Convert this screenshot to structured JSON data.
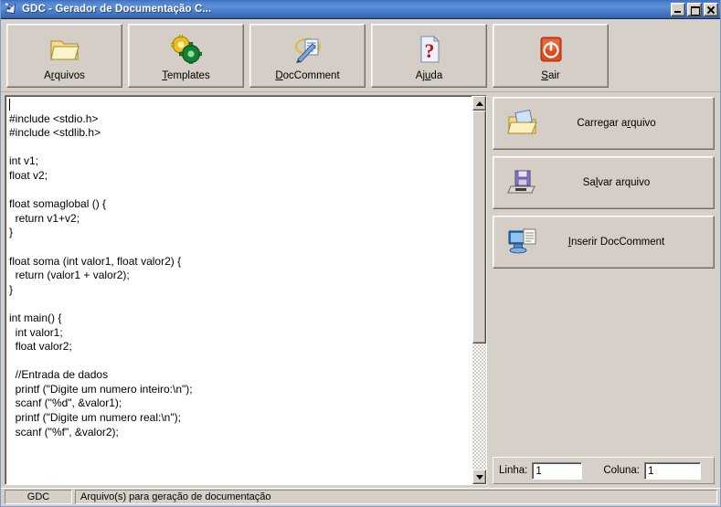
{
  "window": {
    "title": "GDC - Gerador de Documentação C...",
    "icon": "app-icon",
    "buttons": {
      "minimize": "minimize-icon",
      "maximize": "maximize-icon",
      "close": "close-icon"
    }
  },
  "toolbar": {
    "buttons": [
      {
        "label_pre": "A",
        "label_key": "r",
        "label_post": "quivos",
        "icon": "folder-icon",
        "name": "arquivos"
      },
      {
        "label_pre": "",
        "label_key": "T",
        "label_post": "emplates",
        "icon": "gears-icon",
        "name": "templates"
      },
      {
        "label_pre": "",
        "label_key": "D",
        "label_post": "ocComment",
        "icon": "document-pencil-icon",
        "name": "doccomment"
      },
      {
        "label_pre": "Aj",
        "label_key": "u",
        "label_post": "da",
        "icon": "help-question-icon",
        "name": "ajuda"
      },
      {
        "label_pre": "",
        "label_key": "S",
        "label_post": "air",
        "icon": "power-exit-icon",
        "name": "sair"
      }
    ]
  },
  "editor": {
    "code": "\n#include <stdio.h>\n#include <stdlib.h>\n\nint v1;\nfloat v2;\n\nfloat somaglobal () {\n  return v1+v2;\n}\n\nfloat soma (int valor1, float valor2) {\n  return (valor1 + valor2);\n}\n\nint main() {\n  int valor1;\n  float valor2;\n\n  //Entrada de dados\n  printf (\"Digite um numero inteiro:\\n\");\n  scanf (\"%d\", &valor1);\n  printf (\"Digite um numero real:\\n\");\n  scanf (\"%f\", &valor2);\n\n",
    "scrollbar": {
      "up_arrow": "scroll-up-arrow",
      "down_arrow": "scroll-down-arrow",
      "thumb": "scroll-thumb"
    }
  },
  "side_panel": {
    "buttons": [
      {
        "label_pre": "Carregar a",
        "label_key": "r",
        "label_post": "quivo",
        "icon": "open-folder-icon",
        "name": "carregar-arquivo"
      },
      {
        "label_pre": "Sa",
        "label_key": "l",
        "label_post": "var arquivo",
        "icon": "save-disk-icon",
        "name": "salvar-arquivo"
      },
      {
        "label_pre": "",
        "label_key": "I",
        "label_post": "nserir DocComment",
        "icon": "insert-doccomment-icon",
        "name": "inserir-doccomment"
      }
    ],
    "position": {
      "line_label": "Linha:",
      "line_value": "1",
      "column_label": "Coluna:",
      "column_value": "1"
    }
  },
  "statusbar": {
    "app": "GDC",
    "message": "Arquivo(s) para geração de documentação"
  },
  "colors": {
    "window_bg": "#d6d0c8",
    "title_blue": "#4d80cf",
    "editor_bg": "#ffffff",
    "text": "#000000"
  }
}
